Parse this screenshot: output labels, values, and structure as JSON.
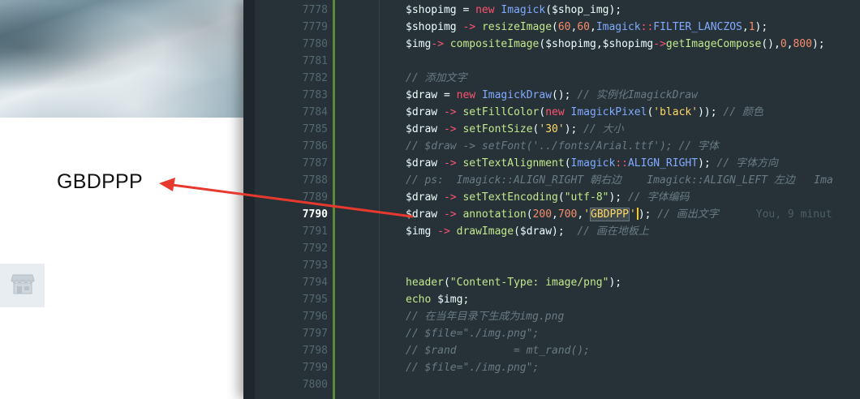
{
  "preview": {
    "rendered_text": "GBDPPP",
    "shop_icon": "storefront-icon"
  },
  "editor": {
    "current_line": "7790",
    "line_numbers": [
      "7778",
      "7779",
      "7780",
      "7781",
      "7782",
      "7783",
      "7784",
      "7785",
      "7786",
      "7787",
      "7788",
      "7789",
      "7790",
      "7791",
      "7792",
      "7793",
      "7794",
      "7795",
      "7796",
      "7797",
      "7798",
      "7799",
      "7800"
    ],
    "lines": {
      "l7778": [
        "$shopimg",
        " = ",
        "new",
        " ",
        "Imagick",
        "($shop_img);"
      ],
      "l7779": [
        "$shopimg",
        " -> ",
        "resizeImage",
        "(",
        "60",
        ",",
        "60",
        ",",
        "Imagick",
        "::",
        "FILTER_LANCZOS",
        ",",
        "1",
        ");"
      ],
      "l7780": [
        "$img",
        "-> ",
        "compositeImage",
        "($shopimg,$shopimg",
        "->",
        "getImageCompose",
        "(),",
        "0",
        ",",
        "800",
        ");"
      ],
      "l7782": "// 添加文字",
      "l7783": [
        "$draw",
        " = ",
        "new",
        " ",
        "ImagickDraw",
        "(); ",
        "// 实例化ImagickDraw"
      ],
      "l7784": [
        "$draw",
        " -> ",
        "setFillColor",
        "(",
        "new",
        " ",
        "ImagickPixel",
        "(",
        "'black'",
        ")); ",
        "// 颜色"
      ],
      "l7785": [
        "$draw",
        " -> ",
        "setFontSize",
        "(",
        "'30'",
        "); ",
        "// 大小"
      ],
      "l7786": "// $draw -> setFont('../fonts/Arial.ttf'); // 字体",
      "l7787": [
        "$draw",
        " -> ",
        "setTextAlignment",
        "(",
        "Imagick",
        "::",
        "ALIGN_RIGHT",
        "); ",
        "// 字体方向"
      ],
      "l7788": "// ps:  Imagick::ALIGN_RIGHT 朝右边    Imagick::ALIGN_LEFT 左边   Ima",
      "l7789": [
        "$draw",
        " -> ",
        "setTextEncoding",
        "(",
        "\"utf-8\"",
        "); ",
        "// 字体编码"
      ],
      "l7790": [
        "$draw",
        " -> ",
        "annotation",
        "(",
        "200",
        ",",
        "700",
        ",",
        "'",
        "GBDPPP",
        "'",
        "); ",
        "// 画出文字",
        "You, 9 minut"
      ],
      "l7791": [
        "$img",
        " -> ",
        "drawImage",
        "($draw);  ",
        "// 画在地板上"
      ],
      "l7794": [
        "header",
        "(",
        "\"Content-Type: image/png\"",
        ");"
      ],
      "l7795": [
        "echo",
        " $img;"
      ],
      "l7796": "// 在当年目录下生成为img.png",
      "l7797": "// $file=\"./img.png\";",
      "l7798": "// $rand         = mt_rand();",
      "l7799": "// $file=\"./img.png\";"
    }
  },
  "colors": {
    "editor_bg": "#263238",
    "arrow": "#e8392f",
    "change_bar": "#5c8a3a"
  }
}
